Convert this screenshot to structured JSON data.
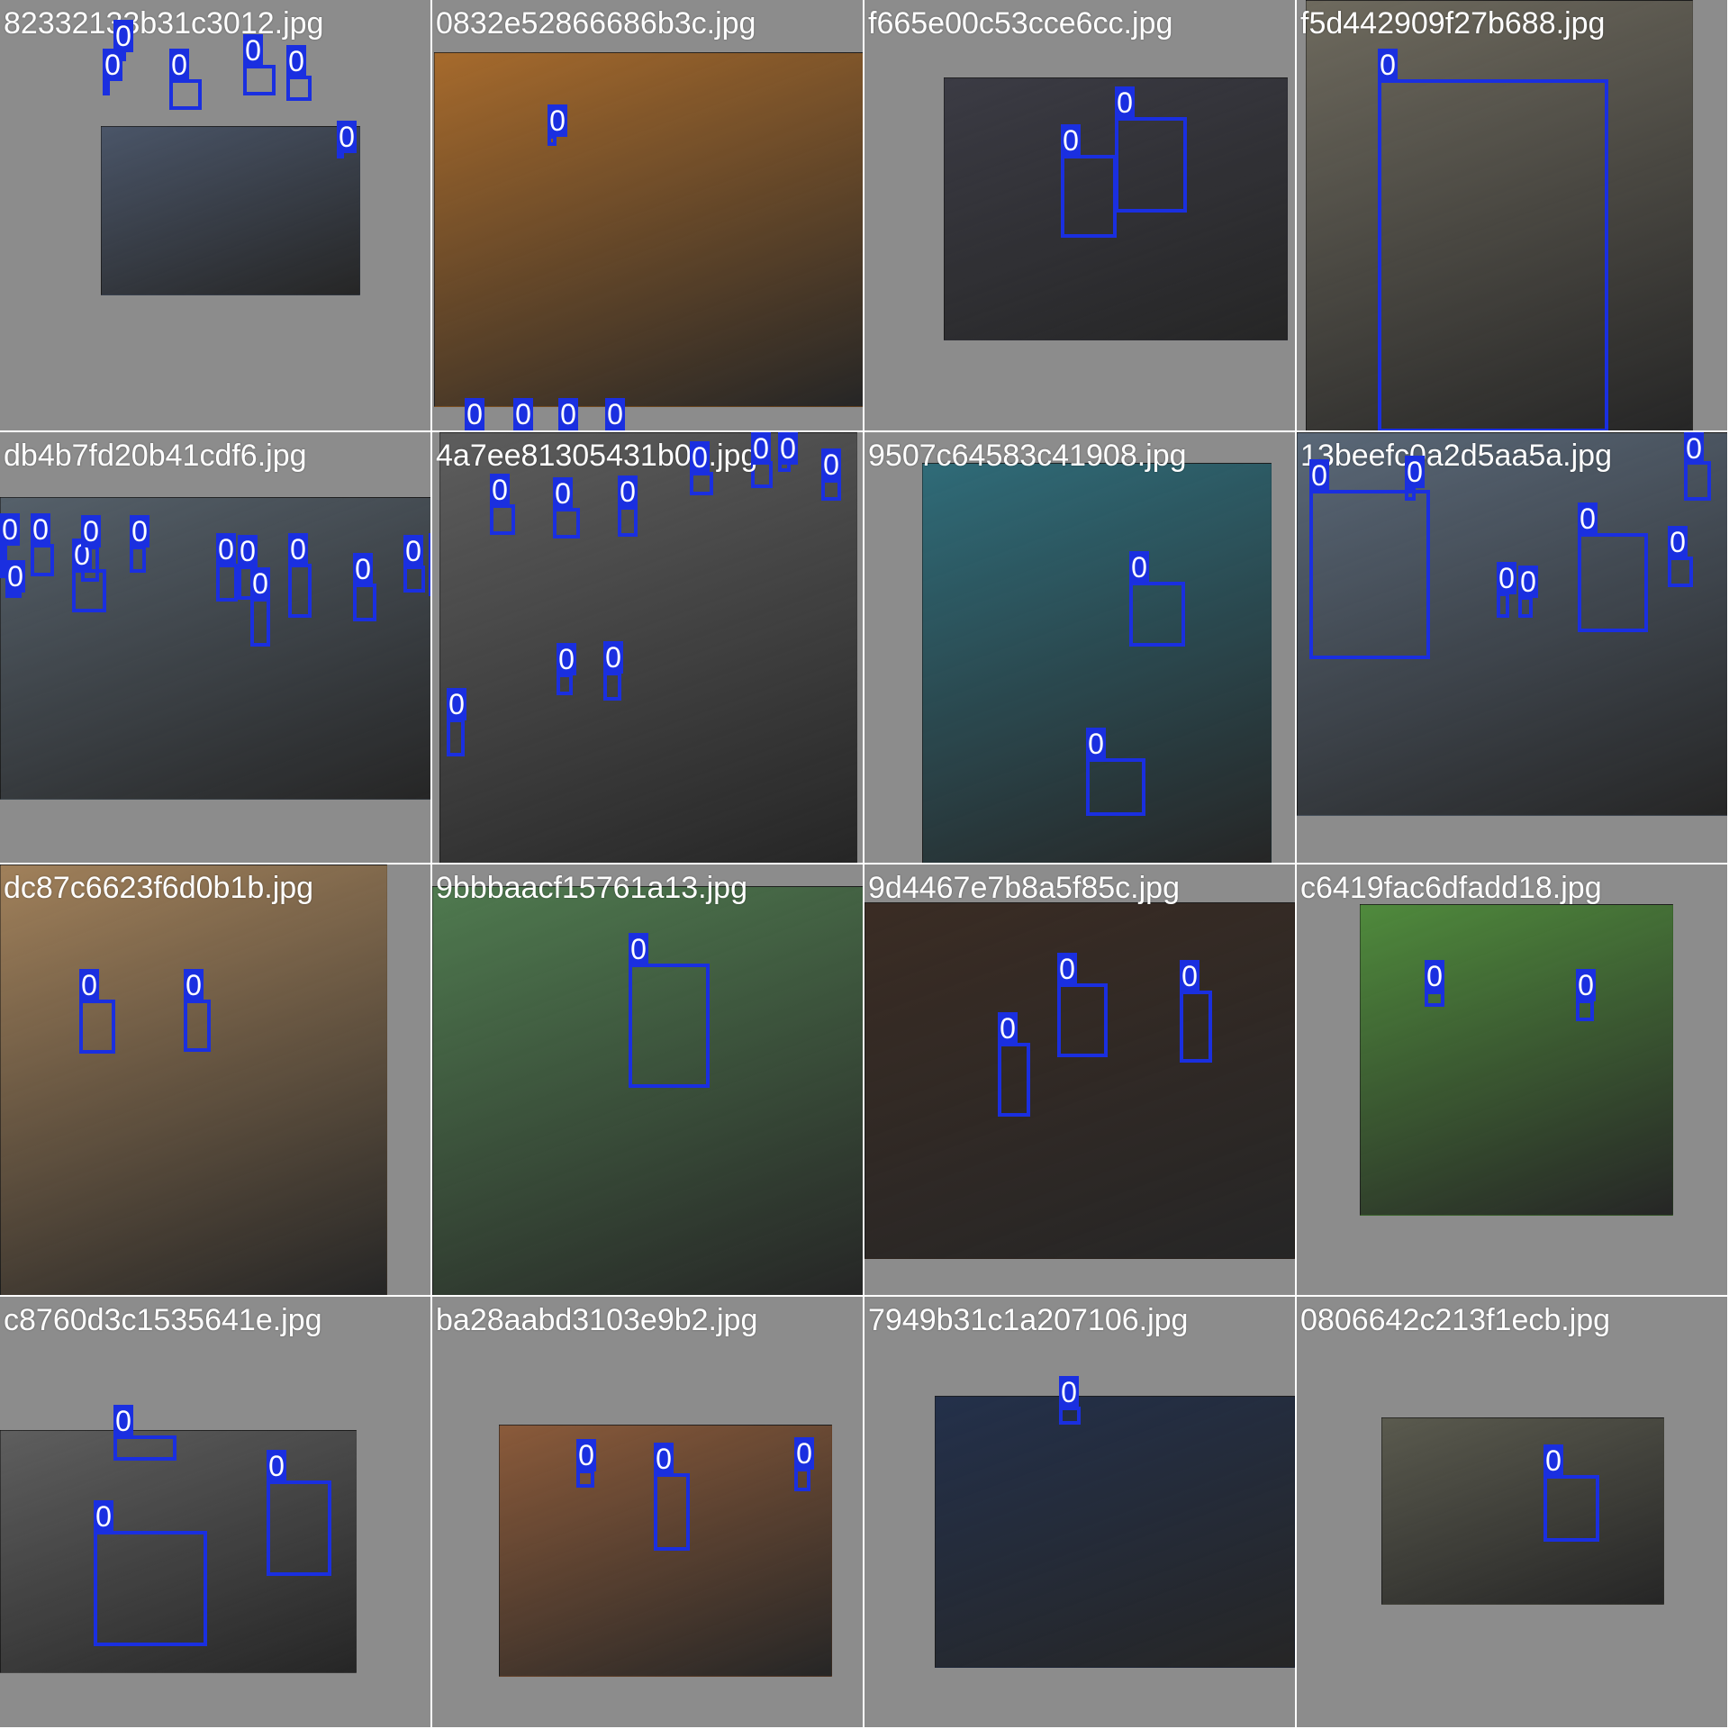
{
  "colors": {
    "box": "#1a2fe0",
    "tile_background": "#8c8c8c",
    "label_text": "#ffffff"
  },
  "class_label": "0",
  "tiles": [
    {
      "file": "82332133b31c3012.jpg",
      "photo_color": "#4a5568",
      "faces": 6
    },
    {
      "file": "0832e52866686b3c.jpg",
      "photo_color": "#a66a2c",
      "faces": 5
    },
    {
      "file": "f665e00c53cce6cc.jpg",
      "photo_color": "#3b3b44",
      "faces": 2
    },
    {
      "file": "f5d442909f27b688.jpg",
      "photo_color": "#6e6a5e",
      "faces": 1
    },
    {
      "file": "db4b7fd20b41cdf6.jpg",
      "photo_color": "#55606a",
      "faces": 13
    },
    {
      "file": "4a7ee81305431b06.jpg",
      "photo_color": "#5d5d5d",
      "faces": 10
    },
    {
      "file": "9507c64583c41908.jpg",
      "photo_color": "#2f6b78",
      "faces": 2
    },
    {
      "file": "13beefc0a2d5aa5a.jpg",
      "photo_color": "#5a6878",
      "faces": 7
    },
    {
      "file": "dc87c6623f6d0b1b.jpg",
      "photo_color": "#a0805a",
      "faces": 2
    },
    {
      "file": "9bbbaacf15761a13.jpg",
      "photo_color": "#4f7a4f",
      "faces": 1
    },
    {
      "file": "9d4467e7b8a5f85c.jpg",
      "photo_color": "#3a2c24",
      "faces": 3
    },
    {
      "file": "c6419fac6dfadd18.jpg",
      "photo_color": "#4f8a3c",
      "faces": 2
    },
    {
      "file": "c8760d3c1535641e.jpg",
      "photo_color": "#5e5e5e",
      "faces": 3
    },
    {
      "file": "ba28aabd3103e9b2.jpg",
      "photo_color": "#8a5a3a",
      "faces": 3
    },
    {
      "file": "7949b31c1a207106.jpg",
      "photo_color": "#23304a",
      "faces": 1
    },
    {
      "file": "0806642c213f1ecb.jpg",
      "photo_color": "#5a5a4e",
      "faces": 1
    }
  ]
}
